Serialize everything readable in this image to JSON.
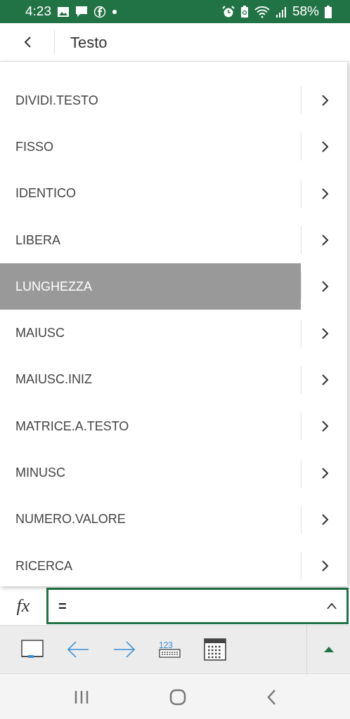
{
  "status_bar": {
    "time": "4:23",
    "battery": "58%"
  },
  "header": {
    "title": "Testo"
  },
  "functions": [
    {
      "name": "DIVIDI.TESTO",
      "selected": false
    },
    {
      "name": "FISSO",
      "selected": false
    },
    {
      "name": "IDENTICO",
      "selected": false
    },
    {
      "name": "LIBERA",
      "selected": false
    },
    {
      "name": "LUNGHEZZA",
      "selected": true
    },
    {
      "name": "MAIUSC",
      "selected": false
    },
    {
      "name": "MAIUSC.INIZ",
      "selected": false
    },
    {
      "name": "MATRICE.A.TESTO",
      "selected": false
    },
    {
      "name": "MINUSC",
      "selected": false
    },
    {
      "name": "NUMERO.VALORE",
      "selected": false
    },
    {
      "name": "RICERCA",
      "selected": false
    }
  ],
  "formula_bar": {
    "label": "fx",
    "value": "="
  },
  "toolbar": {
    "keyboard_label": "123"
  }
}
